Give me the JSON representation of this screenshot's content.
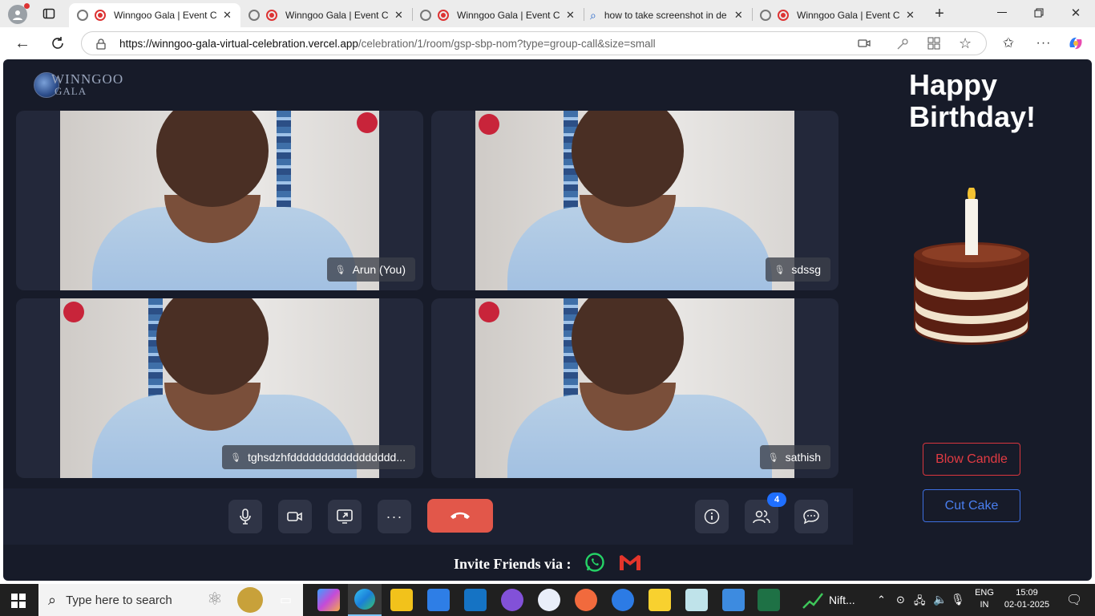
{
  "browser": {
    "tabs": [
      {
        "title": "Winngoo Gala | Event C",
        "active": true,
        "recording": true
      },
      {
        "title": "Winngoo Gala | Event C",
        "active": false,
        "recording": true
      },
      {
        "title": "Winngoo Gala | Event C",
        "active": false,
        "recording": true
      },
      {
        "title": "how to take screenshot in de",
        "active": false,
        "recording": false
      },
      {
        "title": "Winngoo Gala | Event C",
        "active": false,
        "recording": true
      }
    ],
    "url_host": "https://winngoo-gala-virtual-celebration.vercel.app",
    "url_path": "/celebration/1/room/gsp-sbp-nom?type=group-call&size=small"
  },
  "app": {
    "logo_line1": "WINNGOO",
    "logo_line2": "GALA",
    "participants": [
      {
        "name": "Arun (You)"
      },
      {
        "name": "sdssg"
      },
      {
        "name": "tghsdzhfddddddddddddddddd..."
      },
      {
        "name": "sathish"
      }
    ],
    "participant_count": "4",
    "invite_label": "Invite Friends via :",
    "greeting_line1": "Happy",
    "greeting_line2": "Birthday!",
    "blow_candle": "Blow Candle",
    "cut_cake": "Cut Cake",
    "colors": {
      "end_call": "#e2574a",
      "blow": "#e23b43",
      "cut": "#4a7ff0",
      "badge": "#1f6fff"
    }
  },
  "taskbar": {
    "search_placeholder": "Type here to search",
    "nifty_label": "Nift...",
    "lang1": "ENG",
    "lang2": "IN",
    "time": "15:09",
    "date": "02-01-2025"
  }
}
